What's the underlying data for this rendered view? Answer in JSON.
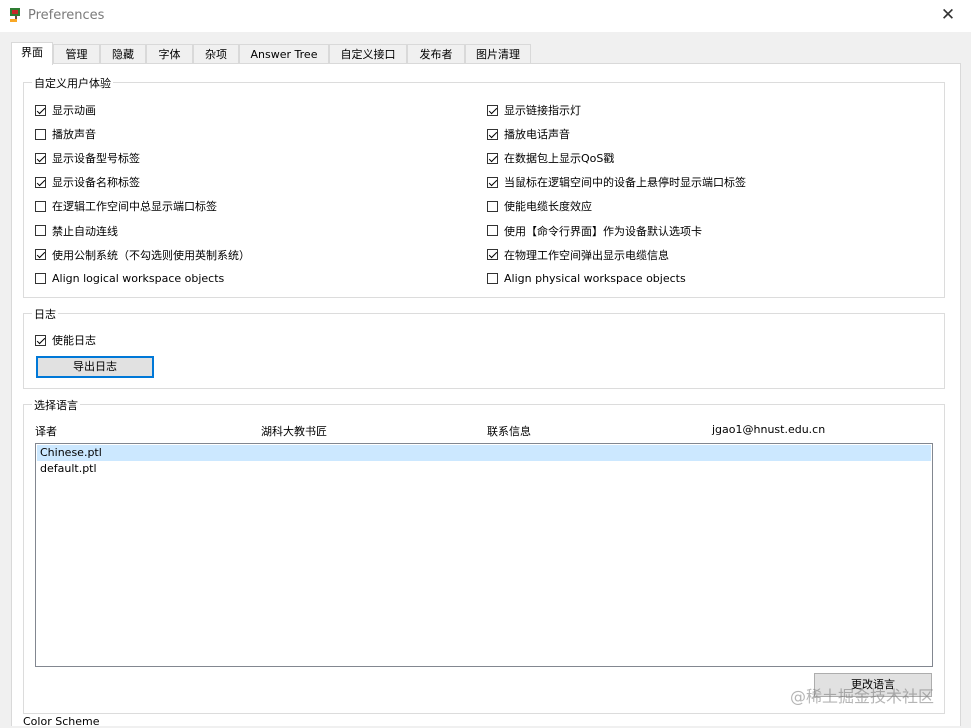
{
  "window": {
    "title": "Preferences",
    "close_glyph": "✕"
  },
  "tabs": [
    "界面",
    "管理",
    "隐藏",
    "字体",
    "杂项",
    "Answer Tree",
    "自定义接口",
    "发布者",
    "图片清理"
  ],
  "ux_group": {
    "title": "自定义用户体验",
    "left": [
      {
        "label": "显示动画",
        "checked": true
      },
      {
        "label": "播放声音",
        "checked": false
      },
      {
        "label": "显示设备型号标签",
        "checked": true
      },
      {
        "label": "显示设备名称标签",
        "checked": true
      },
      {
        "label": "在逻辑工作空间中总显示端口标签",
        "checked": false
      },
      {
        "label": "禁止自动连线",
        "checked": false
      },
      {
        "label": "使用公制系统（不勾选则使用英制系统）",
        "checked": true
      },
      {
        "label": "Align logical workspace objects",
        "checked": false
      }
    ],
    "right": [
      {
        "label": "显示链接指示灯",
        "checked": true
      },
      {
        "label": "播放电话声音",
        "checked": true
      },
      {
        "label": "在数据包上显示QoS戳",
        "checked": true
      },
      {
        "label": "当鼠标在逻辑空间中的设备上悬停时显示端口标签",
        "checked": true
      },
      {
        "label": "使能电缆长度效应",
        "checked": false
      },
      {
        "label": "使用【命令行界面】作为设备默认选项卡",
        "checked": false
      },
      {
        "label": "在物理工作空间弹出显示电缆信息",
        "checked": true
      },
      {
        "label": "Align physical workspace objects",
        "checked": false
      }
    ]
  },
  "log_group": {
    "title": "日志",
    "enable_label": "使能日志",
    "enable_checked": true,
    "export_button": "导出日志"
  },
  "language_group": {
    "title": "选择语言",
    "headers": {
      "translator": "译者",
      "org": "湖科大教书匠",
      "contact": "联系信息",
      "email": "jgao1@hnust.edu.cn"
    },
    "items": [
      "Chinese.ptl",
      "default.ptl"
    ],
    "selected_index": 0,
    "change_button": "更改语言"
  },
  "color_scheme_label": "Color Scheme",
  "watermark": "@稀土掘金技术社区"
}
